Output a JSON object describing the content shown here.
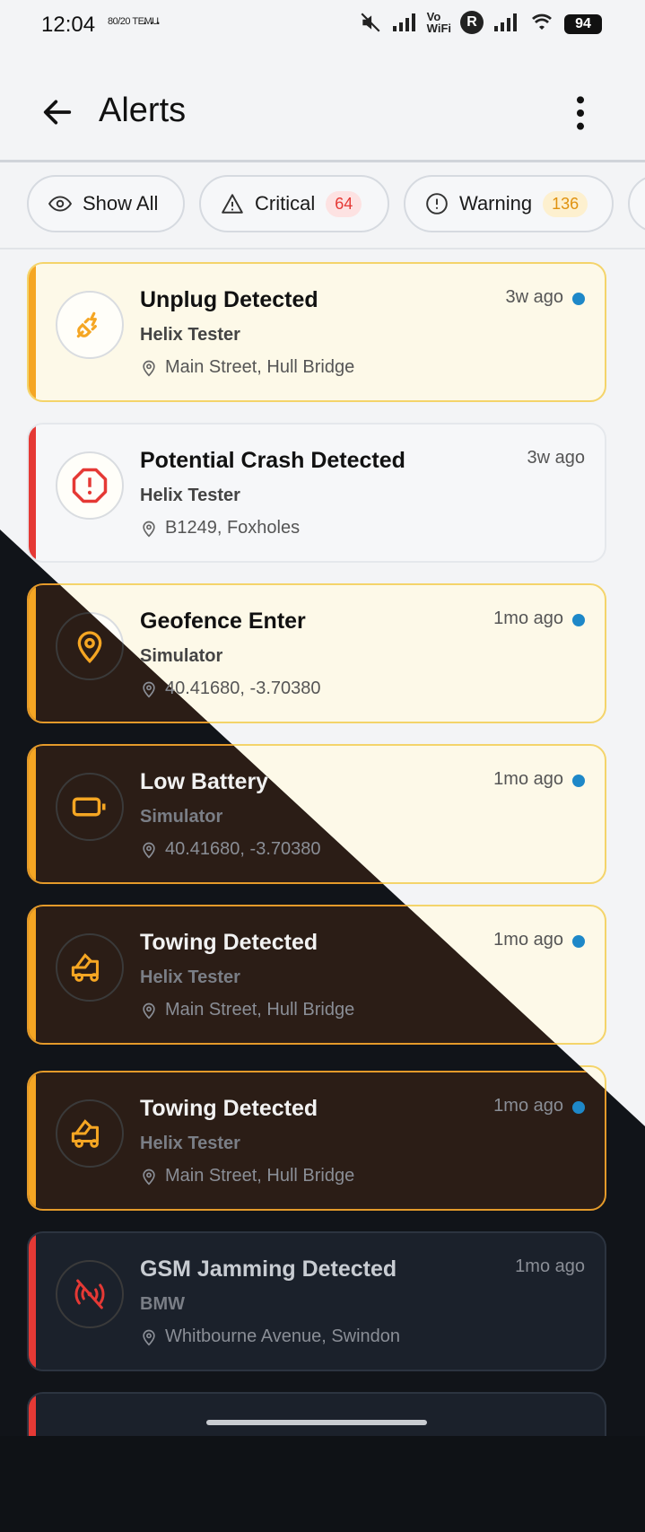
{
  "status_bar": {
    "time": "12:04",
    "mini_text": "80/20 TEMU",
    "battery": "94"
  },
  "header": {
    "title": "Alerts"
  },
  "filters": [
    {
      "label": "Show All",
      "count": ""
    },
    {
      "label": "Critical",
      "count": "64"
    },
    {
      "label": "Warning",
      "count": "136"
    }
  ],
  "alerts": [
    {
      "title": "Unplug Detected",
      "device": "Helix Tester",
      "location": "Main Street, Hull Bridge",
      "time": "3w ago",
      "severity": "warning",
      "unread": true,
      "icon": "plug-icon"
    },
    {
      "title": "Potential Crash Detected",
      "device": "Helix Tester",
      "location": "B1249, Foxholes",
      "time": "3w ago",
      "severity": "critical",
      "unread": false,
      "icon": "octagon-alert-icon"
    },
    {
      "title": "Geofence Enter",
      "device": "Simulator",
      "location": "40.41680, -3.70380",
      "time": "1mo ago",
      "severity": "warning",
      "unread": true,
      "icon": "map-pin-icon"
    },
    {
      "title": "Low Battery",
      "device": "Simulator",
      "location": "40.41680, -3.70380",
      "time": "1mo ago",
      "severity": "warning",
      "unread": true,
      "icon": "battery-icon"
    },
    {
      "title": "Towing Detected",
      "device": "Helix Tester",
      "location": "Main Street, Hull Bridge",
      "time": "1mo ago",
      "severity": "warning",
      "unread": true,
      "icon": "tow-truck-icon"
    },
    {
      "title": "Towing Detected",
      "device": "Helix Tester",
      "location": "Main Street, Hull Bridge",
      "time": "1mo ago",
      "severity": "warning",
      "unread": true,
      "icon": "tow-truck-icon"
    },
    {
      "title": "GSM Jamming Detected",
      "device": "BMW",
      "location": "Whitbourne Avenue, Swindon",
      "time": "1mo ago",
      "severity": "critical",
      "unread": false,
      "icon": "signal-off-icon"
    }
  ],
  "colors": {
    "warning": "#f5a623",
    "critical": "#e53935",
    "unread_dot": "#1e88c8"
  }
}
